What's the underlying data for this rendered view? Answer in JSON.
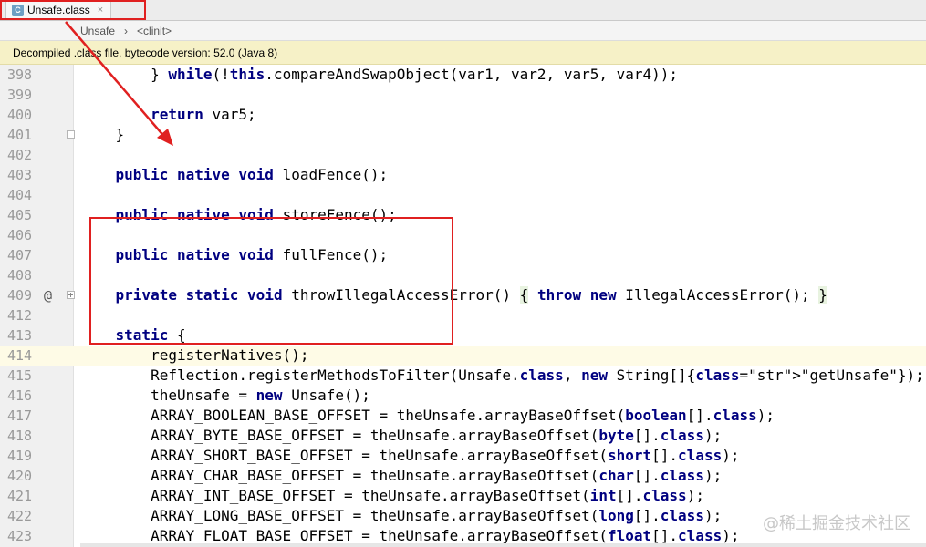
{
  "tab": {
    "icon_letter": "C",
    "label": "Unsafe.class",
    "close": "×"
  },
  "breadcrumb": {
    "items": [
      "Unsafe",
      "›",
      "<clinit>"
    ]
  },
  "banner": {
    "text": "Decompiled .class file, bytecode version: 52.0 (Java 8)"
  },
  "gutter": {
    "annotation": "@"
  },
  "watermark": "@稀土掘金技术社区",
  "lines": [
    {
      "num": "398",
      "code": "        } while(!this.compareAndSwapObject(var1, var2, var5, var4));"
    },
    {
      "num": "399",
      "code": ""
    },
    {
      "num": "400",
      "code": "        return var5;"
    },
    {
      "num": "401",
      "code": "    }"
    },
    {
      "num": "402",
      "code": ""
    },
    {
      "num": "403",
      "code": "    public native void loadFence();"
    },
    {
      "num": "404",
      "code": ""
    },
    {
      "num": "405",
      "code": "    public native void storeFence();"
    },
    {
      "num": "406",
      "code": ""
    },
    {
      "num": "407",
      "code": "    public native void fullFence();"
    },
    {
      "num": "408",
      "code": ""
    },
    {
      "num": "409",
      "code": "    private static void throwIllegalAccessError() { throw new IllegalAccessError(); }"
    },
    {
      "num": "412",
      "code": ""
    },
    {
      "num": "413",
      "code": "    static {"
    },
    {
      "num": "414",
      "code": "        registerNatives();"
    },
    {
      "num": "415",
      "code": "        Reflection.registerMethodsToFilter(Unsafe.class, new String[]{\"getUnsafe\"});"
    },
    {
      "num": "416",
      "code": "        theUnsafe = new Unsafe();"
    },
    {
      "num": "417",
      "code": "        ARRAY_BOOLEAN_BASE_OFFSET = theUnsafe.arrayBaseOffset(boolean[].class);"
    },
    {
      "num": "418",
      "code": "        ARRAY_BYTE_BASE_OFFSET = theUnsafe.arrayBaseOffset(byte[].class);"
    },
    {
      "num": "419",
      "code": "        ARRAY_SHORT_BASE_OFFSET = theUnsafe.arrayBaseOffset(short[].class);"
    },
    {
      "num": "420",
      "code": "        ARRAY_CHAR_BASE_OFFSET = theUnsafe.arrayBaseOffset(char[].class);"
    },
    {
      "num": "421",
      "code": "        ARRAY_INT_BASE_OFFSET = theUnsafe.arrayBaseOffset(int[].class);"
    },
    {
      "num": "422",
      "code": "        ARRAY_LONG_BASE_OFFSET = theUnsafe.arrayBaseOffset(long[].class);"
    },
    {
      "num": "423",
      "code": "        ARRAY_FLOAT_BASE_OFFSET = theUnsafe.arrayBaseOffset(float[].class);"
    }
  ]
}
